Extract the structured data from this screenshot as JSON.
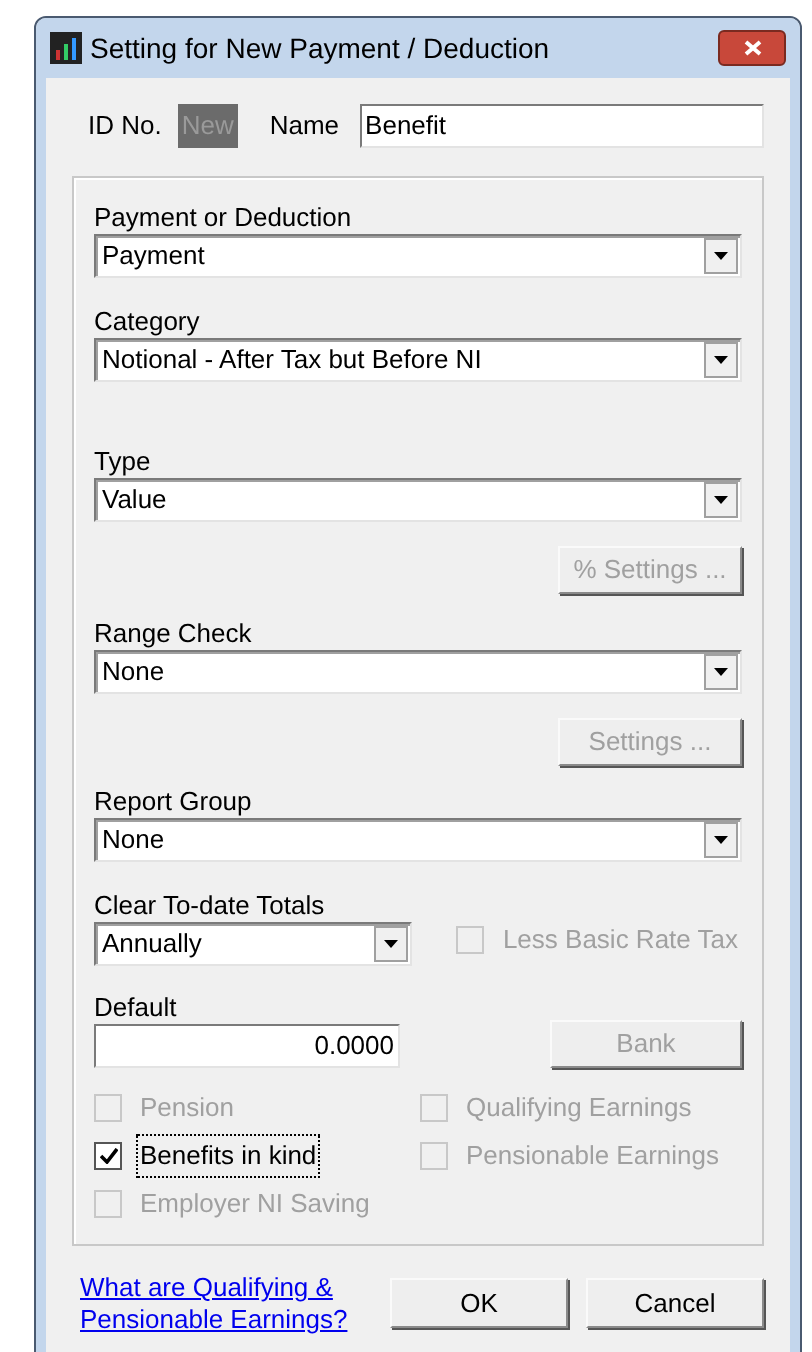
{
  "window": {
    "title": "Setting for New Payment / Deduction"
  },
  "id_field": {
    "label": "ID No.",
    "value": "New",
    "disabled": true
  },
  "name_field": {
    "label": "Name",
    "value": "Benefit"
  },
  "payment_or_deduction": {
    "label": "Payment or Deduction",
    "value": "Payment"
  },
  "category": {
    "label": "Category",
    "value": "Notional - After Tax but Before NI"
  },
  "type": {
    "label": "Type",
    "value": "Value"
  },
  "percent_settings_button": {
    "label": "% Settings ...",
    "disabled": true
  },
  "range_check": {
    "label": "Range Check",
    "value": "None"
  },
  "settings_button": {
    "label": "Settings ...",
    "disabled": true
  },
  "report_group": {
    "label": "Report Group",
    "value": "None"
  },
  "clear_totals": {
    "label": "Clear To-date Totals",
    "value": "Annually"
  },
  "less_basic_rate_tax": {
    "label": "Less Basic Rate Tax",
    "checked": false,
    "disabled": true
  },
  "default": {
    "label": "Default",
    "value": "0.0000"
  },
  "bank_button": {
    "label": "Bank",
    "disabled": true
  },
  "checkboxes_left": [
    {
      "label": "Pension",
      "checked": false,
      "disabled": true,
      "focused": false
    },
    {
      "label": "Benefits in kind",
      "checked": true,
      "disabled": false,
      "focused": true
    },
    {
      "label": "Employer NI Saving",
      "checked": false,
      "disabled": true,
      "focused": false
    }
  ],
  "checkboxes_right": [
    {
      "label": "Qualifying Earnings",
      "checked": false,
      "disabled": true,
      "focused": false
    },
    {
      "label": "Pensionable Earnings",
      "checked": false,
      "disabled": true,
      "focused": false
    }
  ],
  "help_link": "What are Qualifying & Pensionable Earnings?",
  "buttons": [
    {
      "label": "OK"
    },
    {
      "label": "Cancel"
    }
  ]
}
